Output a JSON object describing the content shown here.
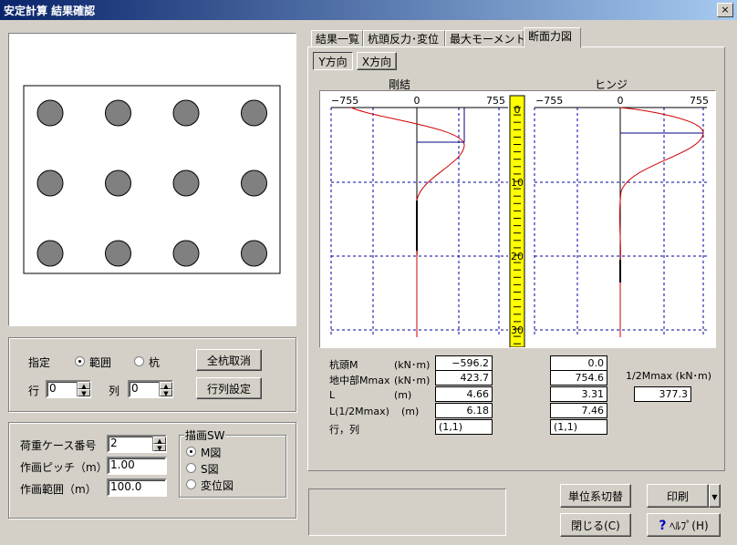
{
  "window": {
    "title": "安定計算 結果確認",
    "close_glyph": "×"
  },
  "tabs": [
    {
      "label": "結果一覧"
    },
    {
      "label": "杭頭反力･変位"
    },
    {
      "label": "最大モーメント"
    },
    {
      "label": "断面力図"
    }
  ],
  "subtabs": [
    {
      "label": "Y方向"
    },
    {
      "label": "X方向"
    }
  ],
  "pile_layout": {
    "rows": 3,
    "cols": 4
  },
  "selection": {
    "label": "指定",
    "range_label": "範囲",
    "pile_label": "杭",
    "row_label": "行",
    "col_label": "列",
    "row_value": "0",
    "col_value": "0",
    "clear_all_button": "全杭取消",
    "set_rowcol_button": "行列設定"
  },
  "load": {
    "case_label": "荷重ケース番号",
    "case_value": "2",
    "pitch_label": "作画ピッチ（m）",
    "pitch_value": "1.00",
    "range_label": "作画範囲（m）",
    "range_value": "100.0"
  },
  "draw_sw": {
    "title": "描画SW",
    "options": [
      "M図",
      "S図",
      "変位図"
    ],
    "selected": 0
  },
  "charts": {
    "left_title": "剛結",
    "right_title": "ヒンジ",
    "left_ticks": [
      "−755",
      "0",
      "755"
    ],
    "right_ticks": [
      "−755",
      "0",
      "755"
    ],
    "depth_labels": [
      "0",
      "10",
      "20",
      "30"
    ]
  },
  "results": {
    "rows": [
      {
        "label": "杭頭M",
        "unit": "(kN･m)",
        "rigid": "−596.2",
        "hinge": "0.0"
      },
      {
        "label": "地中部Mmax",
        "unit": "(kN･m)",
        "rigid": "423.7",
        "hinge": "754.6"
      },
      {
        "label": "L",
        "unit": "(m)",
        "rigid": "4.66",
        "hinge": "3.31"
      },
      {
        "label": "L(1/2Mmax)",
        "unit": "(m)",
        "rigid": "6.18",
        "hinge": "7.46"
      },
      {
        "label": "行，列",
        "unit": "",
        "rigid": "(1,1)",
        "hinge": "(1,1)"
      }
    ],
    "half_mmax_label": "1/2Mmax (kN･m)",
    "half_mmax_value": "377.3"
  },
  "buttons": {
    "unit_switch": "単位系切替",
    "print": "印刷",
    "close": "閉じる(C)",
    "help": "ﾍﾙﾌﾟ(H)"
  }
}
